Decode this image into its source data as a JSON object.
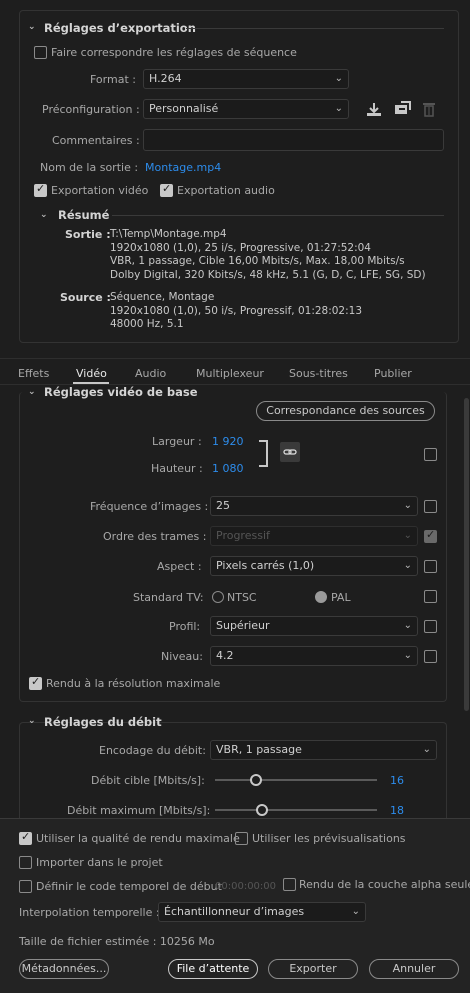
{
  "export_settings": {
    "title": "Réglages d’exportation",
    "match_sequence": "Faire correspondre les réglages de séquence",
    "format_label": "Format :",
    "format_value": "H.264",
    "preset_label": "Préconfiguration :",
    "preset_value": "Personnalisé",
    "comments_label": "Commentaires :",
    "comments_value": "",
    "output_name_label": "Nom de la sortie :",
    "output_name_value": "Montage.mp4",
    "export_video": "Exportation vidéo",
    "export_audio": "Exportation audio",
    "summary_title": "Résumé",
    "output_label": "Sortie :",
    "output_lines": [
      "T:\\Temp\\Montage.mp4",
      "1920x1080 (1,0), 25 i/s, Progressive, 01:27:52:04",
      "VBR, 1 passage, Cible 16,00  Mbits/s, Max. 18,00  Mbits/s",
      "Dolby Digital, 320  Kbits/s, 48  kHz, 5.1 (G, D, C, LFE, SG, SD)"
    ],
    "source_label": "Source :",
    "source_lines": [
      "Séquence, Montage",
      "1920x1080 (1,0), 50  i/s, Progressif, 01:28:02:13",
      "48000 Hz, 5.1"
    ]
  },
  "tabs": [
    "Effets",
    "Vidéo",
    "Audio",
    "Multiplexeur",
    "Sous-titres",
    "Publier"
  ],
  "video_basic": {
    "title": "Réglages vidéo de base",
    "match_source_button": "Correspondance des sources",
    "width_label": "Largeur :",
    "width_value": "1 920",
    "height_label": "Hauteur :",
    "height_value": "1 080",
    "framerate_label": "Fréquence d’images :",
    "framerate_value": "25",
    "field_order_label": "Ordre des trames :",
    "field_order_value": "Progressif",
    "aspect_label": "Aspect :",
    "aspect_value": "Pixels carrés (1,0)",
    "tv_standard_label": "Standard TV:",
    "ntsc": "NTSC",
    "pal": "PAL",
    "profile_label": "Profil:",
    "profile_value": "Supérieur",
    "level_label": "Niveau:",
    "level_value": "4.2",
    "render_max": "Rendu à la résolution maximale"
  },
  "bitrate": {
    "title": "Réglages du débit",
    "encoding_label": "Encodage du débit:",
    "encoding_value": "VBR, 1 passage",
    "target_label": "Débit cible [Mbits/s]:",
    "target_value": "16",
    "max_label": "Débit maximum [Mbits/s]:",
    "max_value": "18"
  },
  "footer": {
    "use_max_render": "Utiliser la qualité de rendu maximale",
    "use_previews": "Utiliser les prévisualisations",
    "import_project": "Importer dans le projet",
    "set_start_tc": "Définir le code temporel de début",
    "start_tc_value": "00:00:00:00",
    "alpha_only": "Rendu de la couche alpha seule",
    "interp_label": "Interpolation temporelle :",
    "interp_value": "Échantillonneur d’images",
    "file_size": "Taille de fichier estimée :  10256 Mo",
    "metadata_button": "Métadonnées...",
    "queue_button": "File d’attente",
    "export_button": "Exporter",
    "cancel_button": "Annuler"
  }
}
